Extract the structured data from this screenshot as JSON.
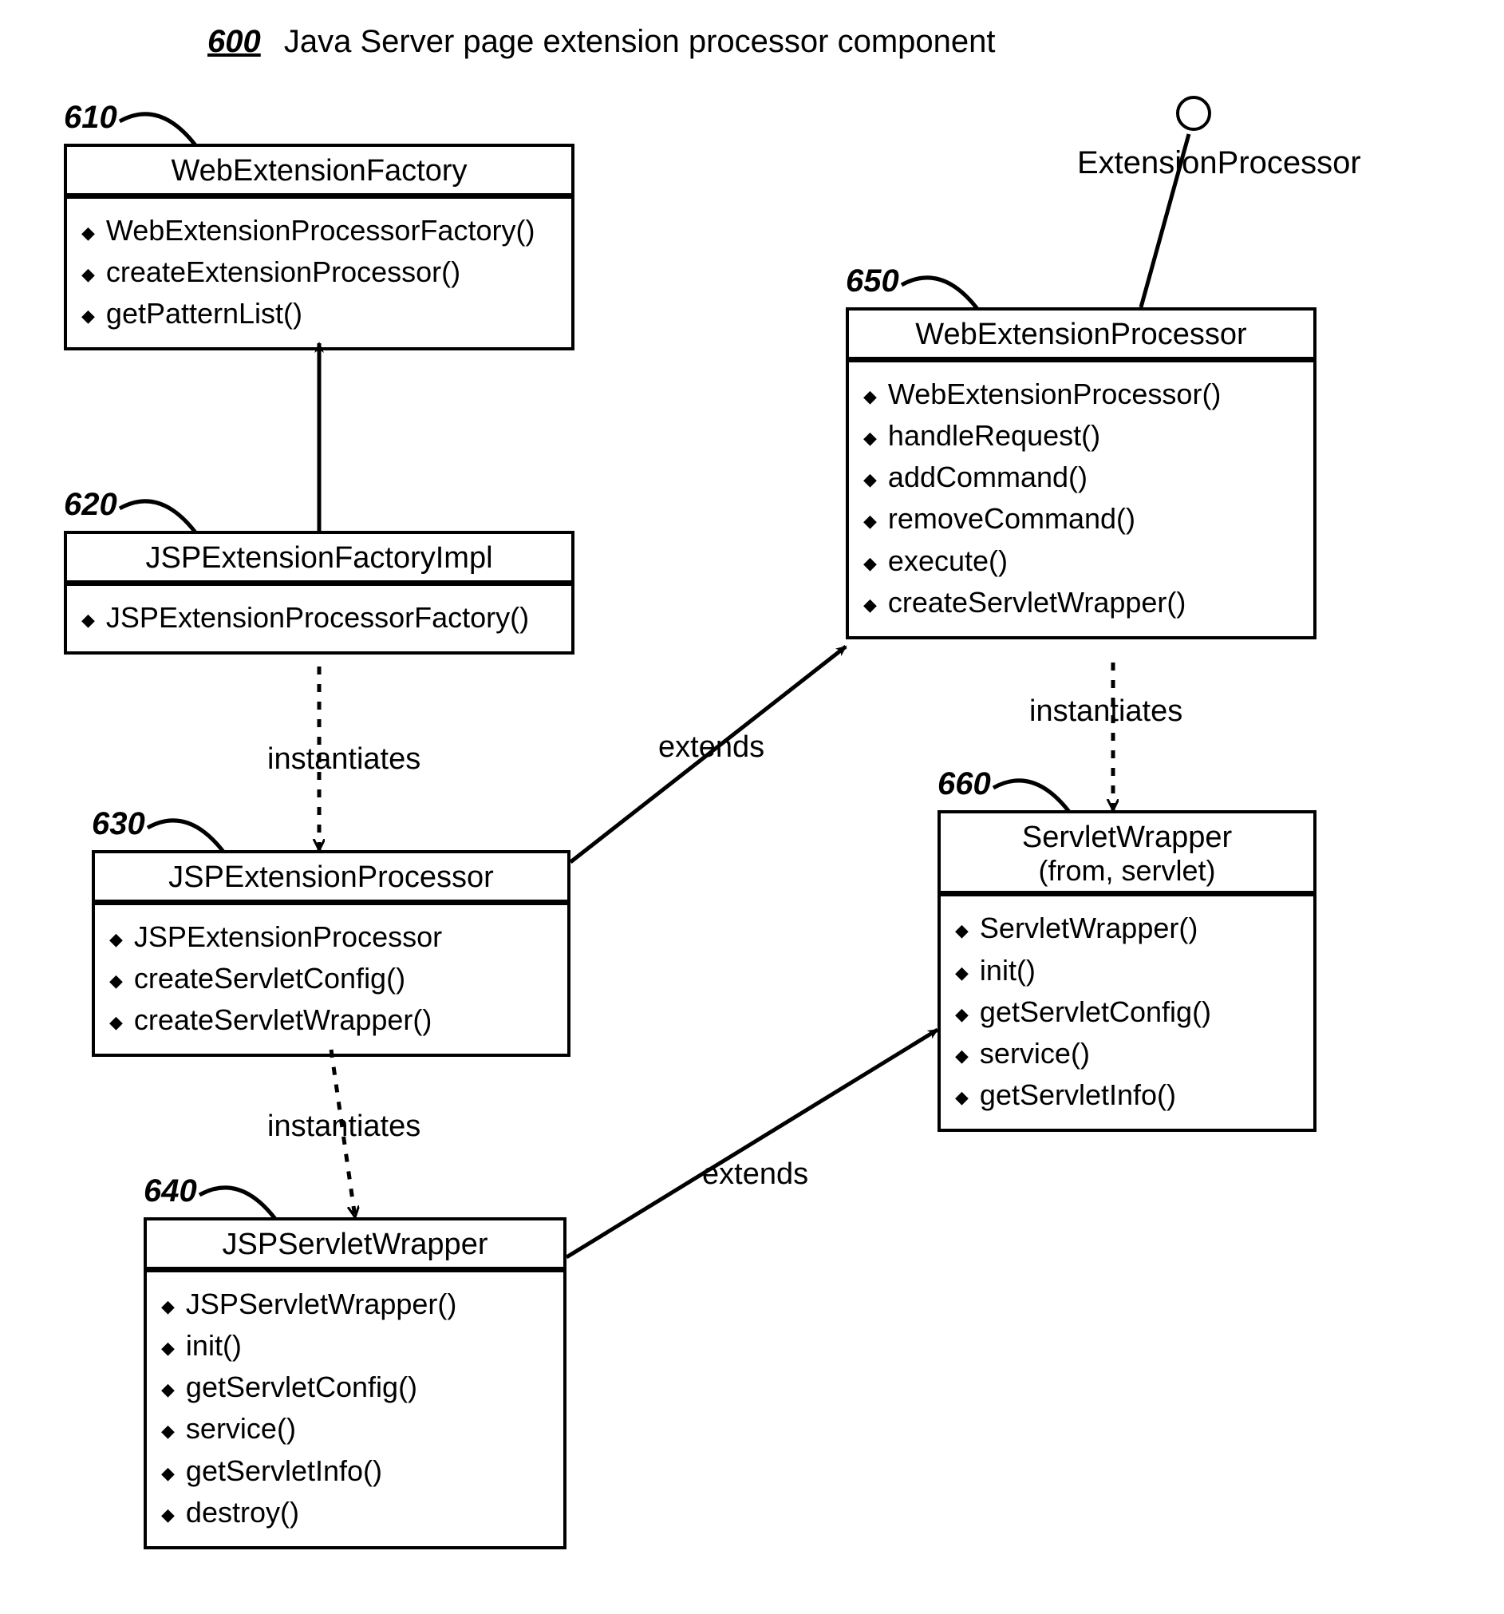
{
  "title": {
    "number": "600",
    "text": "Java Server page extension processor component"
  },
  "interface": {
    "label": "ExtensionProcessor"
  },
  "refs": {
    "b610": "610",
    "b620": "620",
    "b630": "630",
    "b640": "640",
    "b650": "650",
    "b660": "660"
  },
  "edges": {
    "inst1": "instantiates",
    "inst2": "instantiates",
    "inst3": "instantiates",
    "ext1": "extends",
    "ext2": "extends"
  },
  "classes": {
    "b610": {
      "name": "WebExtensionFactory",
      "methods": [
        "WebExtensionProcessorFactory()",
        "createExtensionProcessor()",
        "getPatternList()"
      ]
    },
    "b620": {
      "name": "JSPExtensionFactoryImpl",
      "methods": [
        "JSPExtensionProcessorFactory()"
      ]
    },
    "b630": {
      "name": "JSPExtensionProcessor",
      "methods": [
        "JSPExtensionProcessor",
        "createServletConfig()",
        "createServletWrapper()"
      ]
    },
    "b640": {
      "name": "JSPServletWrapper",
      "methods": [
        "JSPServletWrapper()",
        "init()",
        "getServletConfig()",
        "service()",
        "getServletInfo()",
        "destroy()"
      ]
    },
    "b650": {
      "name": "WebExtensionProcessor",
      "methods": [
        "WebExtensionProcessor()",
        "handleRequest()",
        "addCommand()",
        "removeCommand()",
        "execute()",
        "createServletWrapper()"
      ]
    },
    "b660": {
      "name": "ServletWrapper",
      "name_sub": "(from, servlet)",
      "methods": [
        "ServletWrapper()",
        "init()",
        "getServletConfig()",
        "service()",
        "getServletInfo()"
      ]
    }
  }
}
